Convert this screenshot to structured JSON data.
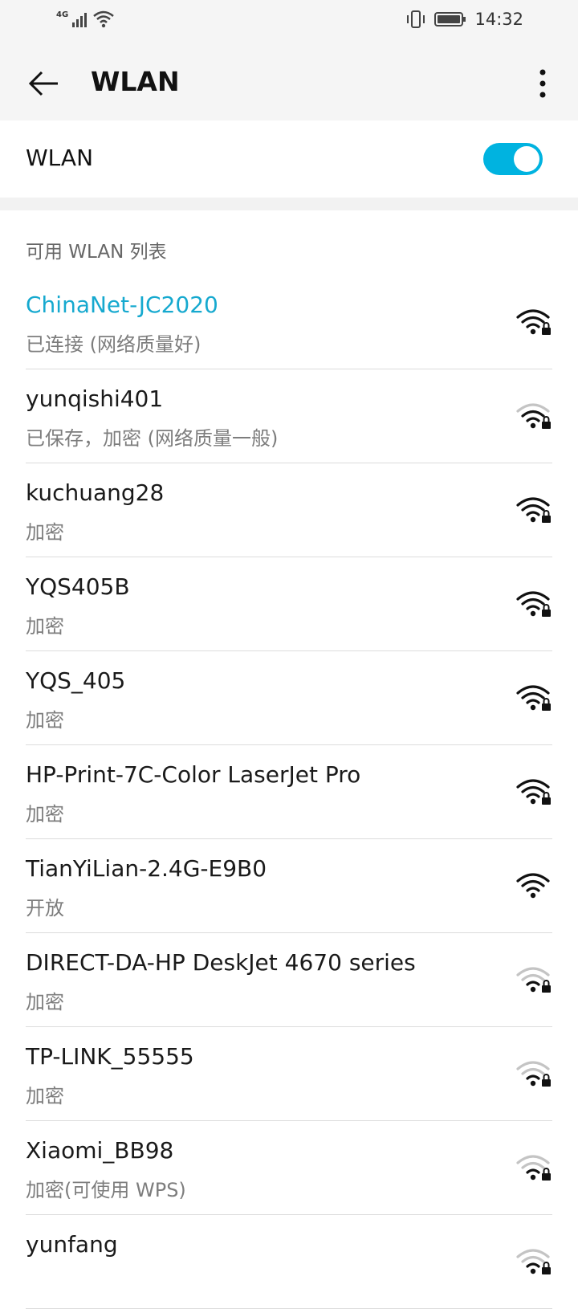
{
  "status_bar": {
    "network_type": "4G",
    "time": "14:32",
    "icons": [
      "signal-icon",
      "wifi-icon",
      "vibrate-icon",
      "battery-icon"
    ]
  },
  "app_bar": {
    "title": "WLAN",
    "back_icon": "back-arrow-icon",
    "more_icon": "more-vert-icon"
  },
  "wlan_toggle": {
    "label": "WLAN",
    "enabled": true,
    "accent_color": "#00b3e0"
  },
  "section_title": "可用 WLAN 列表",
  "networks": [
    {
      "name": "ChinaNet-JC2020",
      "status": "已连接 (网络质量好)",
      "connected": true,
      "signal": "strong",
      "secured": true
    },
    {
      "name": "yunqishi401",
      "status": "已保存，加密 (网络质量一般)",
      "connected": false,
      "signal": "medium",
      "secured": true
    },
    {
      "name": "kuchuang28",
      "status": "加密",
      "connected": false,
      "signal": "strong",
      "secured": true
    },
    {
      "name": "YQS405B",
      "status": "加密",
      "connected": false,
      "signal": "strong",
      "secured": true
    },
    {
      "name": "YQS_405",
      "status": "加密",
      "connected": false,
      "signal": "strong",
      "secured": true
    },
    {
      "name": "HP-Print-7C-Color LaserJet Pro",
      "status": "加密",
      "connected": false,
      "signal": "strong",
      "secured": true
    },
    {
      "name": "TianYiLian-2.4G-E9B0",
      "status": "开放",
      "connected": false,
      "signal": "strong",
      "secured": false
    },
    {
      "name": "DIRECT-DA-HP DeskJet 4670 series",
      "status": "加密",
      "connected": false,
      "signal": "weak",
      "secured": true
    },
    {
      "name": "TP-LINK_55555",
      "status": "加密",
      "connected": false,
      "signal": "weak",
      "secured": true
    },
    {
      "name": "Xiaomi_BB98",
      "status": "加密(可使用 WPS)",
      "connected": false,
      "signal": "weak",
      "secured": true
    },
    {
      "name": "yunfang",
      "status": "",
      "connected": false,
      "signal": "weak",
      "secured": true
    }
  ]
}
